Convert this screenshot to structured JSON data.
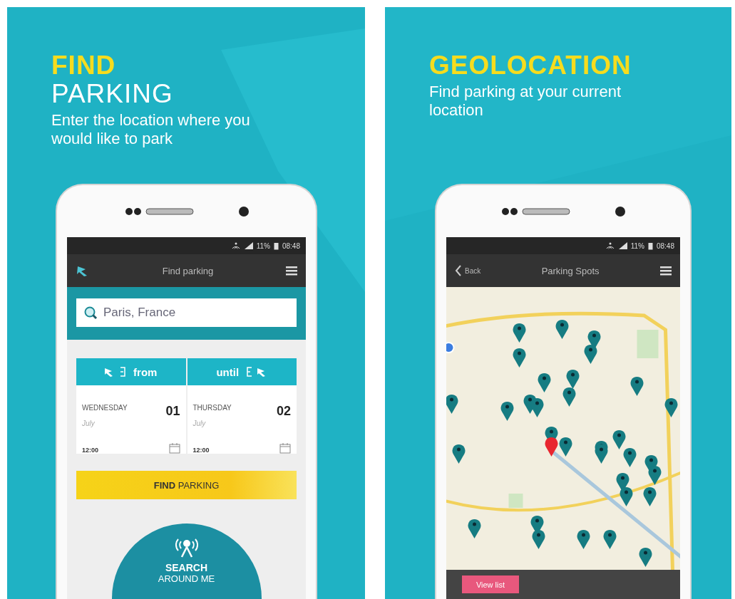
{
  "panels": [
    {
      "kind": "form",
      "headline": [
        {
          "text": "FIND",
          "accent": true
        },
        {
          "text": "PARKING",
          "accent": false
        }
      ],
      "subtitle": "Enter the location where you would like to park",
      "status_bar": {
        "battery": "11%",
        "time": "08:48"
      },
      "app_bar": {
        "title": "Find parking"
      },
      "search": {
        "value": "Paris, France"
      },
      "from_tab": "from",
      "until_tab": "until",
      "dates": [
        {
          "weekday": "WEDNESDAY",
          "month": "July",
          "day": "01",
          "time": "12:00"
        },
        {
          "weekday": "THURSDAY",
          "month": "July",
          "day": "02",
          "time": "12:00"
        }
      ],
      "find_button": "**FIND** PARKING",
      "around_button": {
        "line_1": "SEARCH",
        "line_2": "AROUND ME"
      }
    },
    {
      "kind": "map",
      "headline": [
        {
          "text": "GEOLOCATION",
          "accent": true
        }
      ],
      "subtitle": "Find parking at your current location",
      "status_bar": {
        "battery": "11%",
        "time": "08:48"
      },
      "app_bar": {
        "back": "Back",
        "title": "Parking Spots"
      },
      "view_list_button": "View list"
    }
  ]
}
